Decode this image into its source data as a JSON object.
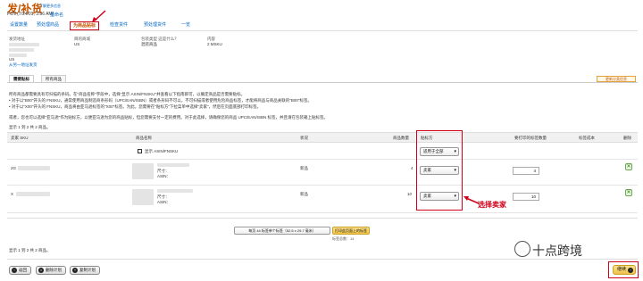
{
  "header": {
    "title": "发/补货",
    "help_link": "了解更多信息",
    "subtitle": "PLN (7/24/01, 3:36 AM)",
    "subtitle_link": "重命名"
  },
  "tabs": [
    {
      "label": "设置数量"
    },
    {
      "label": "预处理商品"
    },
    {
      "label": "为商品贴标",
      "active": true
    },
    {
      "label": "检查货件"
    },
    {
      "label": "预处理货件"
    },
    {
      "label": "一览"
    }
  ],
  "info": {
    "ship_from_h": "发货地址",
    "ship_from_lines": [
      "US"
    ],
    "ship_from_link": "从另一地址发货",
    "marketplace_h": "目的商城",
    "marketplace_v": "US",
    "packing_h": "包装类型 这是什么？",
    "packing_v": "混装商品",
    "content_h": "内容",
    "content_v": "2 MSKU"
  },
  "subtabs": [
    "需要贴标",
    "所有商品"
  ],
  "warn_badge": "更新分类信息",
  "notes": [
    "所有商品都需要具有可扫描的条码。在\"商品名称\"字段中，选择\"显示 ASIN/FNSKU\"并查看以下指南即可，以确定商品是否需要贴标。",
    "• 对于以\"B00\"开头的 FNSKU，通常使用商品制造商条形码（UPC/EAN/ISBN）或者条形码不可以，不可扫描或者使用危险商品标签，才能将商品与商品关联的\"B00\"标签。",
    "• 对于以\"X00\"开头的 FNSKU，商品将由亚马逊标签的\"X00\"标签。为此，您需要在\"贴标方\"下拉菜单中选择\"卖家\"，然后在页面底部打印标签。",
    "或者，您也可以选择\"亚马逊\"作为贴标方，以便亚马逊为您的商品贴标，但您需要支付一定的费用。对于此选择，请确保您的商品 UPC/EAN/ISBN 标签，并且请在包装箱上贴标签。"
  ],
  "pagination_top": "显示 1 到 2 共 2 商品。",
  "pagination_bottom": "显示 1 到 2 共 2 商品。",
  "table": {
    "headers": [
      "卖家 SKU",
      "商品名称",
      "状况",
      "商品数量",
      "贴标方",
      "要打印的标签数量",
      "标签成本",
      "删除"
    ],
    "show_asin_label": "显示 ASIN/FNSKU",
    "apply_all_option": "适用于全部",
    "rows": [
      {
        "sku": "2G",
        "condition": "新品",
        "units": "4",
        "labeled_by": "卖家",
        "labels_to_print": "4"
      },
      {
        "sku": "X",
        "condition": "新品",
        "units": "10",
        "labeled_by": "卖家",
        "labels_to_print": "10"
      }
    ],
    "row_details": [
      "尺寸：",
      "ASIN："
    ],
    "delete_glyph": "✕"
  },
  "annotation": "选择卖家",
  "footer": {
    "label_format": "每页 44 标签单个标签（52.5 x 29.7 毫米）",
    "print_button": "打印此页面上的标签",
    "label_count": "标签总数：14",
    "back_button": "返回",
    "delete_plan_button": "删除计划",
    "copy_plan_button": "复制计划",
    "continue_button": "继续"
  },
  "watermark": "十点跨境"
}
